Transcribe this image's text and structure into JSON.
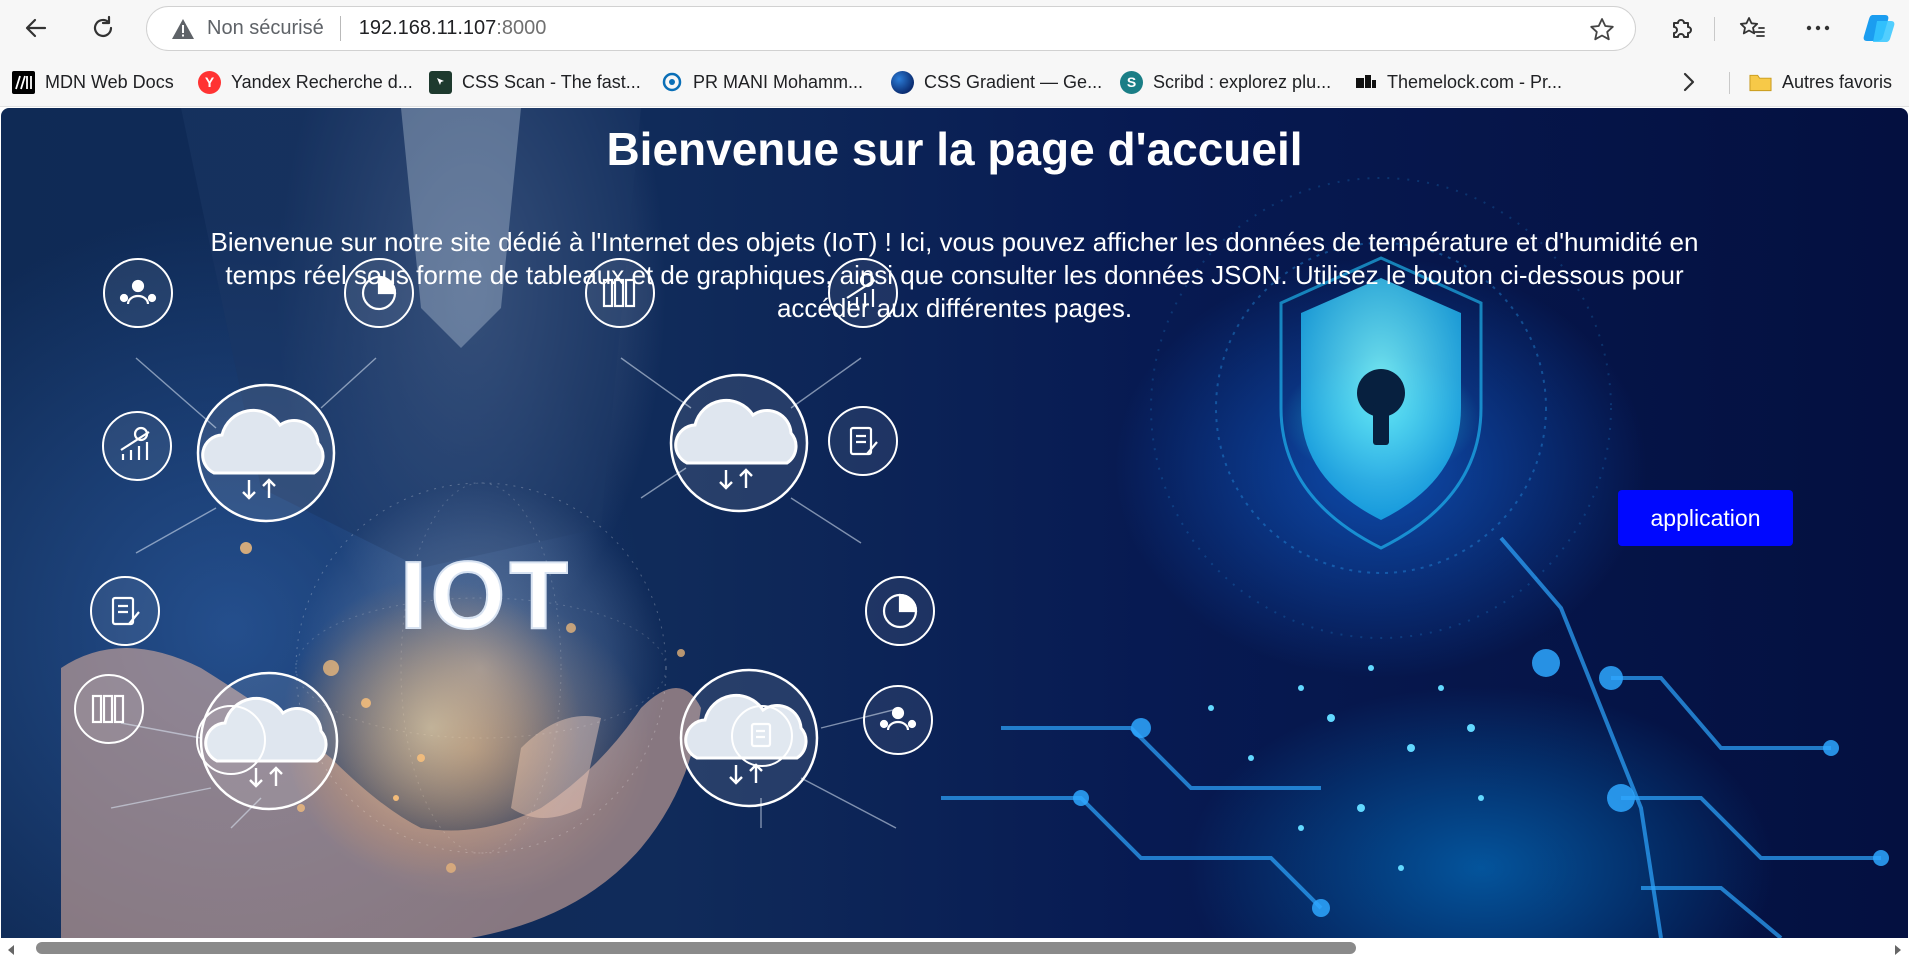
{
  "browser": {
    "address": {
      "security_label": "Non sécurisé",
      "host": "192.168.11.107",
      "port": ":8000"
    },
    "bookmarks": [
      {
        "label": "MDN Web Docs",
        "icon": "mdn-icon"
      },
      {
        "label": "Yandex Recherche d...",
        "icon": "yandex-icon"
      },
      {
        "label": "CSS Scan - The fast...",
        "icon": "css-scan-icon"
      },
      {
        "label": "PR MANI Mohamm...",
        "icon": "pr-icon"
      },
      {
        "label": "CSS Gradient — Ge...",
        "icon": "css-gradient-icon"
      },
      {
        "label": "Scribd : explorez plu...",
        "icon": "scribd-icon"
      },
      {
        "label": "Themelock.com - Pr...",
        "icon": "themelock-icon"
      }
    ],
    "other_favorites": "Autres favoris"
  },
  "page": {
    "title": "Bienvenue sur la page d'accueil",
    "intro": "Bienvenue sur notre site dédié à l'Internet des objets (IoT) ! Ici, vous pouvez afficher les données de température et d'humidité en temps réel sous forme de tableaux et de graphiques, ainsi que consulter les données JSON. Utilisez le bouton ci-dessous pour accéder aux différentes pages.",
    "button_label": "application",
    "hero_text": "IOT",
    "colors": {
      "button": "#0008ff",
      "title": "#ffffff"
    }
  }
}
